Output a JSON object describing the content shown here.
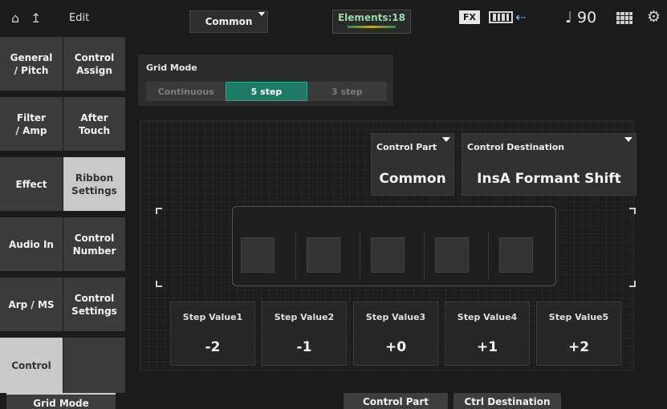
{
  "topbar": {
    "edit_label": "Edit",
    "part_selector": "Common",
    "elements": "Elements:18",
    "fx": "FX",
    "tempo": "♩ 90"
  },
  "nav": {
    "col1": [
      {
        "label": "General\n/ Pitch"
      },
      {
        "label": "Filter\n/ Amp"
      },
      {
        "label": "Effect"
      },
      {
        "label": "Audio In"
      },
      {
        "label": "Arp / MS"
      },
      {
        "label": "Control"
      }
    ],
    "col2": [
      {
        "label": "Control\nAssign"
      },
      {
        "label": "After\nTouch"
      },
      {
        "label": "Ribbon\nSettings"
      },
      {
        "label": "Control\nNumber"
      },
      {
        "label": "Control\nSettings"
      },
      {
        "label": ""
      }
    ]
  },
  "grid_mode": {
    "label": "Grid Mode",
    "options": [
      "Continuous",
      "5 step",
      "3 step"
    ],
    "selected": "5 step"
  },
  "control_part": {
    "label": "Control Part",
    "value": "Common"
  },
  "control_destination": {
    "label": "Control Destination",
    "value": "InsA Formant Shift"
  },
  "steps": [
    {
      "label": "Step Value1",
      "value": "-2"
    },
    {
      "label": "Step Value2",
      "value": "-1"
    },
    {
      "label": "Step Value3",
      "value": "+0"
    },
    {
      "label": "Step Value4",
      "value": "+1"
    },
    {
      "label": "Step Value5",
      "value": "+2"
    }
  ],
  "bottombar": {
    "grid_mode": "Grid Mode",
    "control_part": "Control Part",
    "ctrl_destination": "Ctrl Destination"
  },
  "colors": {
    "accent": "#1e7a66",
    "selected_nav": "#c9c9c9",
    "nav_bg": "#3b3b3b"
  }
}
